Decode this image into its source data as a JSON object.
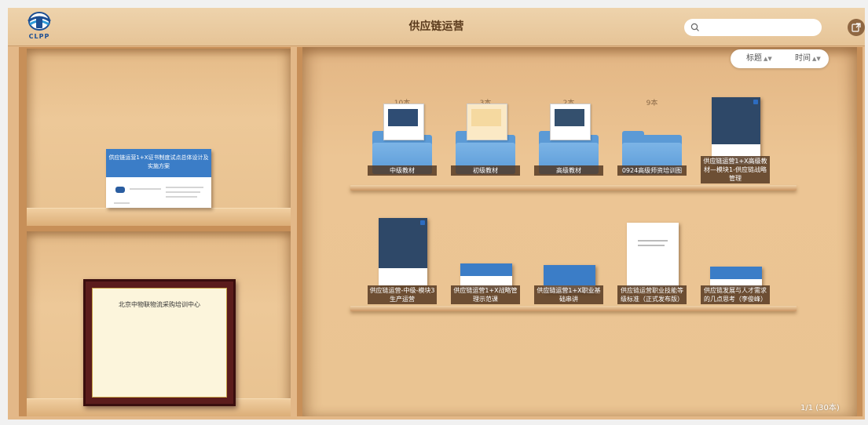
{
  "header": {
    "title": "供应链运营",
    "logo_text": "CLPP",
    "search_placeholder": ""
  },
  "sort": {
    "title_label": "标题",
    "time_label": "时间",
    "arrow": "▲▼"
  },
  "left_shelf": {
    "plan_book_title": "供应链运营1+X证书制度试点总体设计及实施方案",
    "certificate_text": "北京中物联物流采购培训中心"
  },
  "shelf_row1": [
    {
      "count": "10本",
      "label": "中级教材"
    },
    {
      "count": "3本",
      "label": "初级教材"
    },
    {
      "count": "2本",
      "label": "高级教材"
    },
    {
      "count": "9本",
      "label": "0924高级师资培训图"
    },
    {
      "count": "",
      "label": "供应链运营1+X高级教材—模块1-供应链战略管理"
    }
  ],
  "shelf_row2": [
    {
      "label": "供应链运营-中级-模块3生产运营"
    },
    {
      "label": "供应链运营1+X战略管理示范课"
    },
    {
      "label": "供应链运营1+X职业基础串讲"
    },
    {
      "label": "供应链运营职业技能等级标准（正式发布版）"
    },
    {
      "label": "供应链发展与人才需求的几点思考（李俊峰）"
    }
  ],
  "pager": "1/1 (30本)",
  "colors": {
    "wood": "#e3b888",
    "folder_blue": "#5b9ad6",
    "label_bg": "#50341e",
    "cover_blue": "#3b7dc7"
  }
}
